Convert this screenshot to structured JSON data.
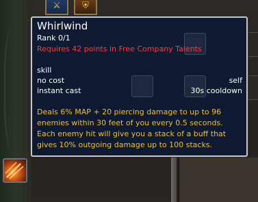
{
  "tooltip": {
    "title": "Whirlwind",
    "rank": "Rank 0/1",
    "requirement": "Requires 42 points in Free Company Talents",
    "type": "skill",
    "cost": "no cost",
    "target": "self",
    "cast": "instant cast",
    "cooldown": "30s cooldown",
    "description_lines": [
      "Deals 6% MAP + 20 piercing damage to up to 96",
      "enemies within 30 feet of you every 0.5 seconds.",
      "Each enemy hit will give you a stack of a buff that",
      "gives 10% outgoing damage up to 100 stacks."
    ]
  },
  "icons": {
    "ability": "whirlwind-icon",
    "top_slot_1": "sword-icon",
    "top_slot_2": "shield-icon"
  },
  "colors": {
    "tooltip_bg": "#0e1a34",
    "title": "#ffffff",
    "requirement": "#ff3a3a",
    "description": "#f0c030",
    "border": "#c8c8c8"
  }
}
